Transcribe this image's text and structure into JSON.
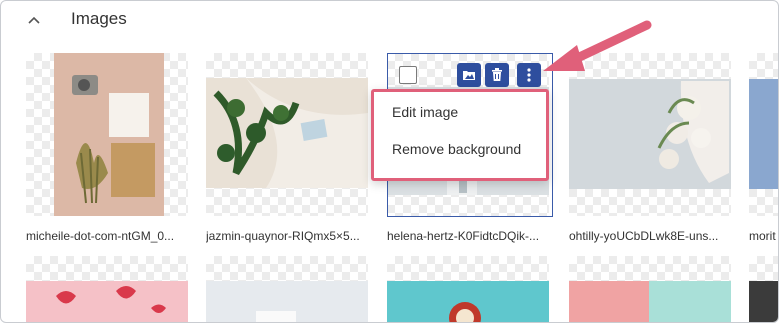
{
  "section": {
    "title": "Images"
  },
  "images": [
    {
      "caption": "micheile-dot-com-ntGM_0..."
    },
    {
      "caption": "jazmin-quaynor-RIQmx5×5..."
    },
    {
      "caption": "helena-hertz-K0FidtcDQik-..."
    },
    {
      "caption": "ohtilly-yoUCbDLwk8E-uns..."
    },
    {
      "caption": "morit"
    }
  ],
  "context_menu": {
    "items": [
      "Edit image",
      "Remove background"
    ]
  },
  "icons": {
    "collapse": "chevron-up-icon",
    "folder": "folder-image-icon",
    "delete": "trash-icon",
    "more": "more-vertical-icon"
  },
  "colors": {
    "accent": "#2e4e9e",
    "highlight": "#e0607a"
  }
}
